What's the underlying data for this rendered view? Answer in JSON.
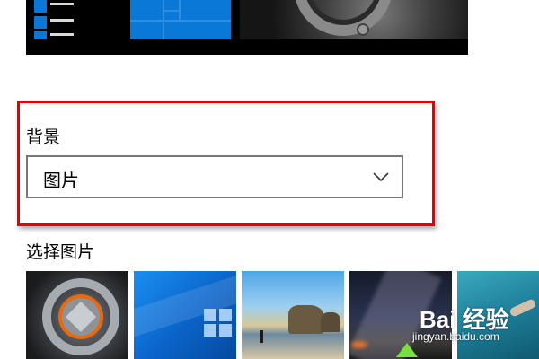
{
  "background": {
    "label": "背景",
    "selected_value": "图片"
  },
  "picture": {
    "label": "选择图片",
    "thumbnails": [
      {
        "name": "gear-wallpaper"
      },
      {
        "name": "windows-blue-wallpaper"
      },
      {
        "name": "beach-rocks-wallpaper"
      },
      {
        "name": "night-sky-wallpaper"
      },
      {
        "name": "underwater-wallpaper"
      }
    ]
  },
  "watermark": {
    "brand": "Bai 经验",
    "site": "jingyan.baidu.com"
  },
  "colors": {
    "accent": "#0a78d6",
    "highlight": "#e60000"
  }
}
